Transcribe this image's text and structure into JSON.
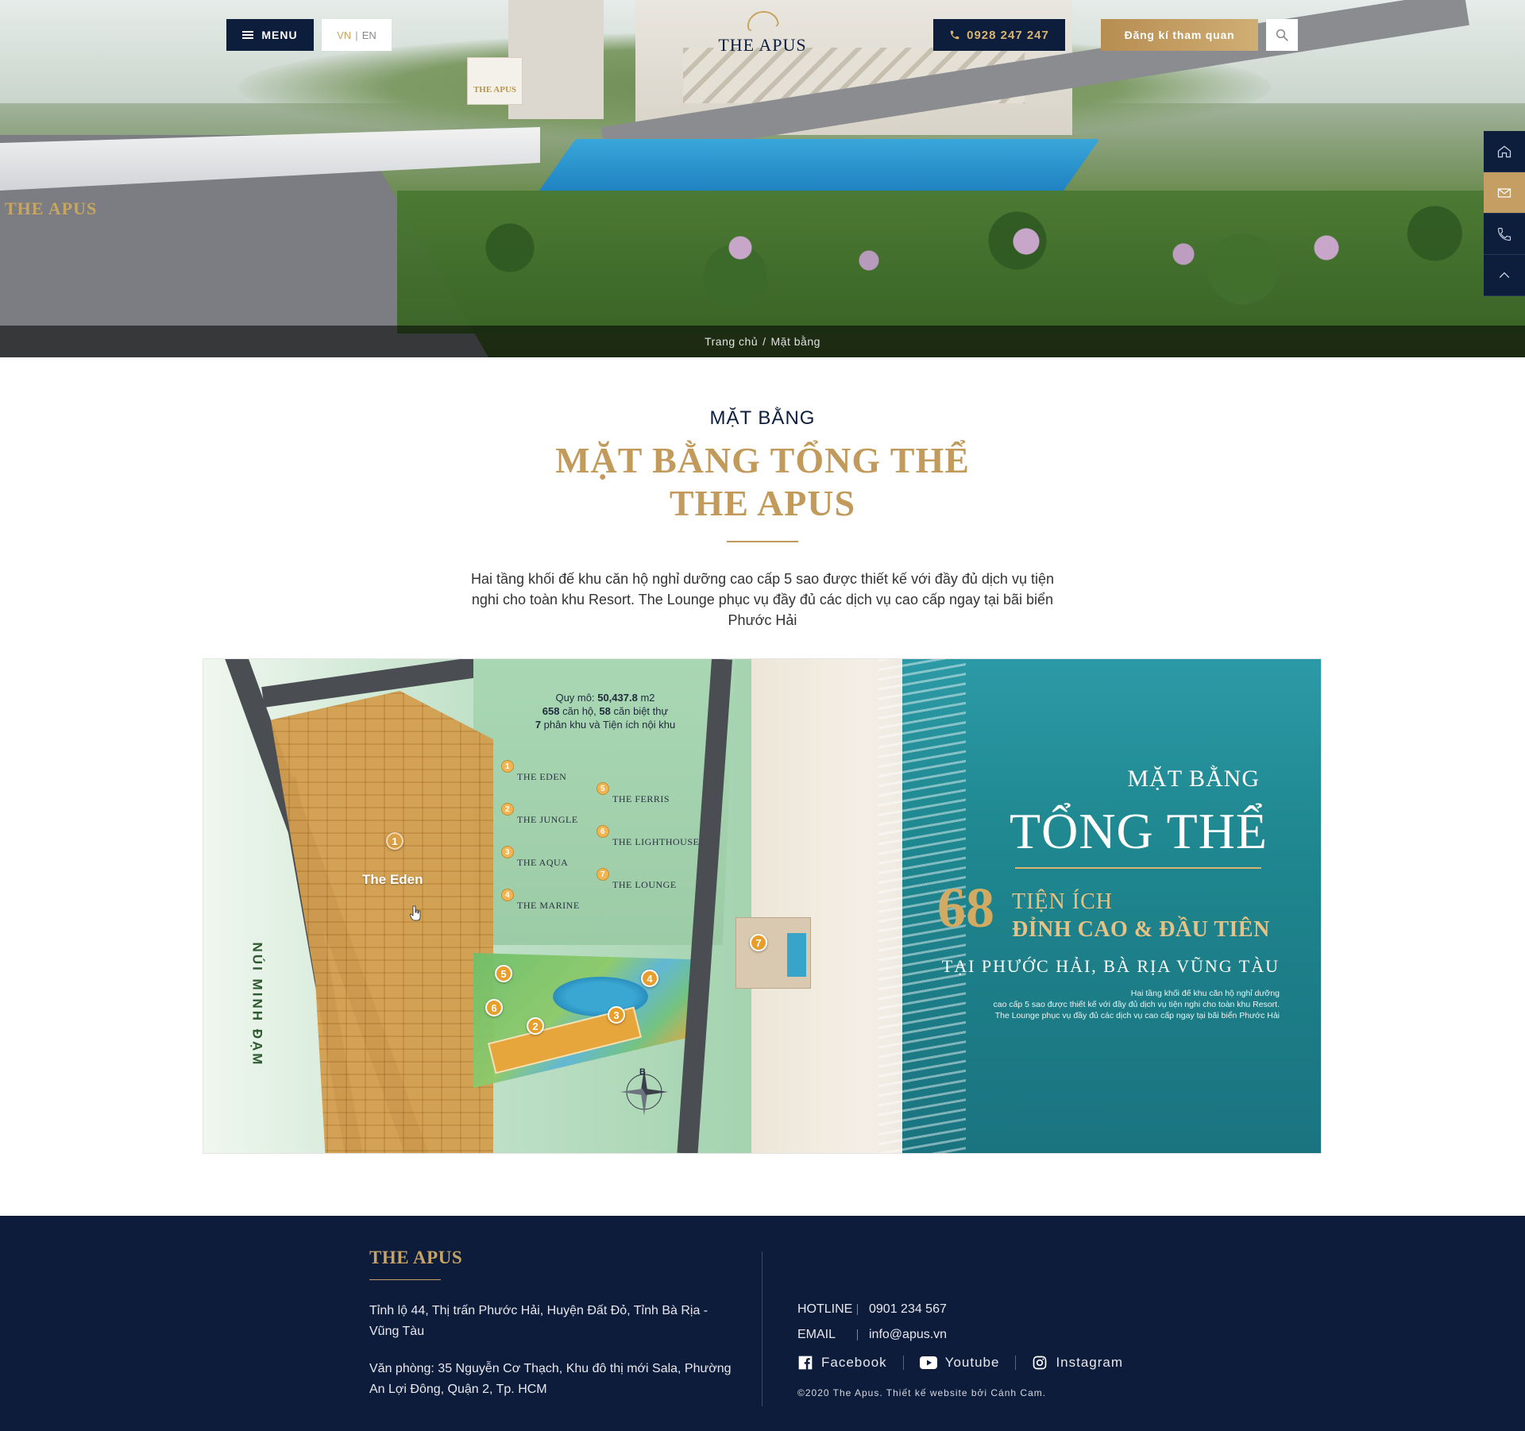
{
  "header": {
    "menu_label": "MENU",
    "lang_vn": "VN",
    "lang_sep": "|",
    "lang_en": "EN",
    "logo_text": "THE APUS",
    "phone": "0928 247 247",
    "visit_label": "Đăng kí tham quan"
  },
  "hero": {
    "sign_text": "THE APUS",
    "bridge_text": "THE APUS"
  },
  "breadcrumb": {
    "home": "Trang chủ",
    "separator": "/",
    "current": "Mặt bằng"
  },
  "side_nav": [
    "home-icon",
    "mail-icon",
    "phone-icon",
    "chevron-up-icon"
  ],
  "section": {
    "subtitle": "MẶT BẰNG",
    "title_line1": "MẶT BẰNG TỔNG THỂ",
    "title_line2": "THE APUS",
    "intro": "Hai tầng khối đế khu căn hộ nghỉ dưỡng cao cấp 5 sao được thiết kế với đầy đủ dịch vụ tiện nghi cho toàn khu Resort. The Lounge phục vụ đầy đủ các dịch vụ cao cấp ngay tại bãi biển Phước Hải"
  },
  "map": {
    "summary": {
      "scale_label": "Quy mô:",
      "scale_value": "50,437.8",
      "scale_unit": "m2",
      "apartments_value": "658",
      "apartments_label": "căn hộ,",
      "villas_value": "58",
      "villas_label": "căn biệt thự",
      "zones_value": "7",
      "zones_label": "phân khu và Tiện ích nội khu"
    },
    "zones_left": [
      {
        "num": "1",
        "name": "THE EDEN"
      },
      {
        "num": "2",
        "name": "THE JUNGLE"
      },
      {
        "num": "3",
        "name": "THE AQUA"
      },
      {
        "num": "4",
        "name": "THE MARINE"
      }
    ],
    "zones_right": [
      {
        "num": "5",
        "name": "THE FERRIS"
      },
      {
        "num": "6",
        "name": "THE LIGHTHOUSE"
      },
      {
        "num": "7",
        "name": "THE LOUNGE"
      }
    ],
    "markers": [
      "1",
      "2",
      "3",
      "4",
      "5",
      "6",
      "7"
    ],
    "hover_label": "The Eden",
    "mountain_label": "NÚI MINH ĐẠM",
    "compass_label": "B",
    "promo": {
      "line1": "MẶT BẰNG",
      "line2": "TỔNG THỂ",
      "number": "68",
      "tag1": "TIỆN ÍCH",
      "tag2": "ĐỈNH CAO & ĐẦU TIÊN",
      "location": "TẠI PHƯỚC HẢI, BÀ RỊA VŨNG TÀU",
      "desc1": "Hai tầng khối đế khu căn hộ nghỉ dưỡng",
      "desc2": "cao cấp 5 sao được thiết kế với đầy đủ dịch vụ tiện nghi cho toàn khu Resort.",
      "desc3": "The Lounge phục vụ đầy đủ các dịch vụ cao cấp ngay tại bãi biển Phước Hải"
    }
  },
  "footer": {
    "brand": "THE APUS",
    "address": "Tỉnh lộ 44, Thị trấn Phước Hải, Huyện Đất Đỏ, Tỉnh Bà Rịa - Vũng Tàu",
    "office": "Văn phòng: 35 Nguyễn Cơ Thạch, Khu đô thị mới Sala, Phường An Lợi Đông, Quận 2, Tp. HCM",
    "hotline_label": "HOTLINE",
    "hotline_value": "0901 234 567",
    "email_label": "EMAIL",
    "email_value": "info@apus.vn",
    "social": {
      "facebook": "Facebook",
      "youtube": "Youtube",
      "instagram": "Instagram"
    },
    "copyright": "©2020 The Apus. Thiết kế website bởi Cánh Cam."
  },
  "colors": {
    "navy": "#0d1e3d",
    "gold": "#c29a5b",
    "footer_bg": "#0c1c3a",
    "sea": "#1f8890"
  }
}
